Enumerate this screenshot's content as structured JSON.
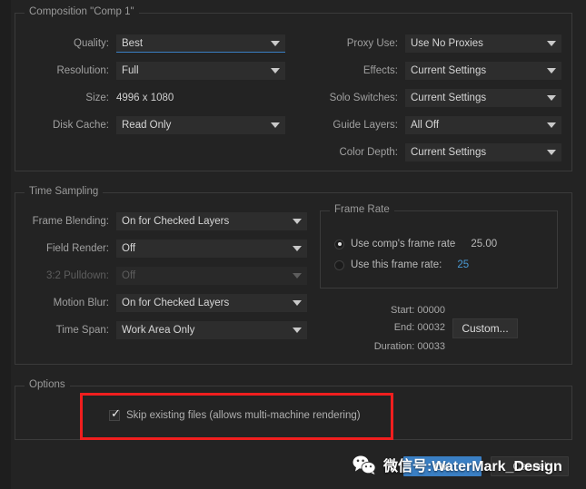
{
  "composition": {
    "title": "Composition \"Comp 1\"",
    "rows": [
      {
        "label": "Quality:",
        "value": "Best",
        "type": "dropdown",
        "focused": true,
        "disabled": false
      },
      {
        "label": "Resolution:",
        "value": "Full",
        "type": "dropdown",
        "focused": false,
        "disabled": false
      },
      {
        "label": "Size:",
        "value": "4996 x 1080",
        "type": "text",
        "focused": false,
        "disabled": false
      },
      {
        "label": "Disk Cache:",
        "value": "Read Only",
        "type": "dropdown",
        "focused": false,
        "disabled": false
      }
    ],
    "right_rows": [
      {
        "label": "Proxy Use:",
        "value": "Use No Proxies",
        "type": "dropdown"
      },
      {
        "label": "Effects:",
        "value": "Current Settings",
        "type": "dropdown"
      },
      {
        "label": "Solo Switches:",
        "value": "Current Settings",
        "type": "dropdown"
      },
      {
        "label": "Guide Layers:",
        "value": "All Off",
        "type": "dropdown"
      },
      {
        "label": "Color Depth:",
        "value": "Current Settings",
        "type": "dropdown"
      }
    ]
  },
  "time_sampling": {
    "title": "Time Sampling",
    "rows": [
      {
        "label": "Frame Blending:",
        "value": "On for Checked Layers",
        "disabled": false
      },
      {
        "label": "Field Render:",
        "value": "Off",
        "disabled": false
      },
      {
        "label": "3:2 Pulldown:",
        "value": "Off",
        "disabled": true
      },
      {
        "label": "Motion Blur:",
        "value": "On for Checked Layers",
        "disabled": false
      },
      {
        "label": "Time Span:",
        "value": "Work Area Only",
        "disabled": false
      }
    ],
    "frame_rate": {
      "title": "Frame Rate",
      "option_comp_label": "Use comp's frame rate",
      "option_comp_value": "25.00",
      "option_comp_selected": true,
      "option_this_label": "Use this frame rate:",
      "option_this_value": "25",
      "option_this_selected": false
    },
    "time_fields": [
      {
        "label": "Start:",
        "value": "00000"
      },
      {
        "label": "End:",
        "value": "00032"
      },
      {
        "label": "Duration:",
        "value": "00033"
      }
    ],
    "custom_button": "Custom..."
  },
  "options": {
    "title": "Options",
    "skip_existing_label": "Skip existing files (allows multi-machine rendering)",
    "skip_existing_checked": true,
    "highlight_color": "#f01e1e"
  },
  "footer": {
    "ok_label": "OK",
    "cancel_label": "Cancel"
  },
  "watermark": {
    "text": "微信号:WaterMark_Design",
    "icon": "wechat-icon"
  },
  "colors": {
    "background": "#232323",
    "panel_border": "#3b3b3b",
    "field_bg": "#2d2d2d",
    "accent_blue": "#3a7fc4",
    "highlight_red": "#f01e1e"
  }
}
